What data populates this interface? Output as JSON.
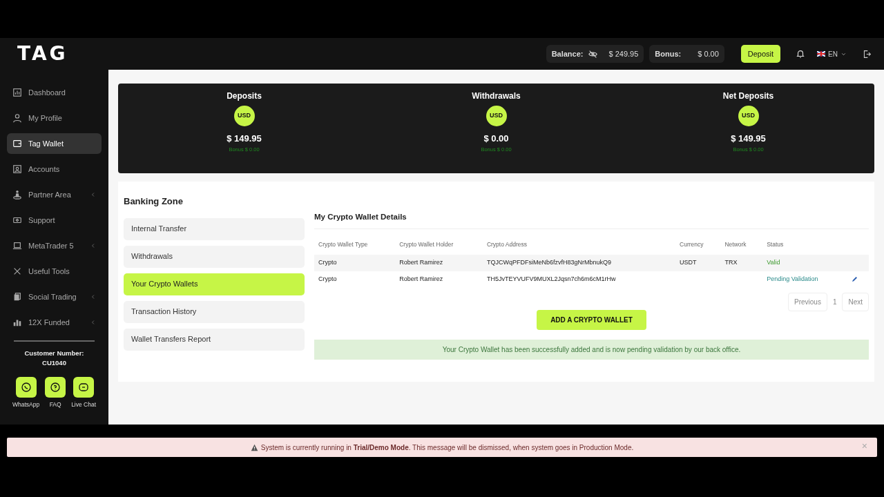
{
  "brand": "TAG",
  "header": {
    "balance_label": "Balance:",
    "balance_value": "$ 249.95",
    "bonus_label": "Bonus:",
    "bonus_value": "$ 0.00",
    "deposit_button": "Deposit",
    "language": "EN"
  },
  "sidebar": {
    "items": [
      {
        "label": "Dashboard",
        "selected": false,
        "submenu": false
      },
      {
        "label": "My Profile",
        "selected": false,
        "submenu": false
      },
      {
        "label": "Tag Wallet",
        "selected": true,
        "submenu": false
      },
      {
        "label": "Accounts",
        "selected": false,
        "submenu": false
      },
      {
        "label": "Partner Area",
        "selected": false,
        "submenu": true
      },
      {
        "label": "Support",
        "selected": false,
        "submenu": false
      },
      {
        "label": "MetaTrader 5",
        "selected": false,
        "submenu": true
      },
      {
        "label": "Useful Tools",
        "selected": false,
        "submenu": false
      },
      {
        "label": "Social Trading",
        "selected": false,
        "submenu": true
      },
      {
        "label": "12X Funded",
        "selected": false,
        "submenu": true
      }
    ],
    "customer_label": "Customer Number:",
    "customer_number": "CU1040",
    "contacts": [
      {
        "label": "WhatsApp"
      },
      {
        "label": "FAQ"
      },
      {
        "label": "Live Chat"
      }
    ]
  },
  "summary": [
    {
      "title": "Deposits",
      "currency": "USD",
      "amount": "$ 149.95",
      "bonus": "Bonus $ 0.00"
    },
    {
      "title": "Withdrawals",
      "currency": "USD",
      "amount": "$ 0.00",
      "bonus": "Bonus $ 0.00"
    },
    {
      "title": "Net Deposits",
      "currency": "USD",
      "amount": "$ 149.95",
      "bonus": "Bonus $ 0.00"
    }
  ],
  "banking_zone": {
    "title": "Banking Zone",
    "menu": [
      {
        "label": "Internal Transfer",
        "selected": false
      },
      {
        "label": "Withdrawals",
        "selected": false
      },
      {
        "label": "Your Crypto Wallets",
        "selected": true
      },
      {
        "label": "Transaction History",
        "selected": false
      },
      {
        "label": "Wallet Transfers Report",
        "selected": false
      }
    ]
  },
  "wallets": {
    "title": "My Crypto Wallet Details",
    "columns": [
      "Crypto Wallet Type",
      "Crypto Wallet Holder",
      "Crypto Address",
      "Currency",
      "Network",
      "Status"
    ],
    "rows": [
      {
        "cells": [
          "Crypto",
          "Robert Ramirez",
          "TQJCWqPFDFsiMeNb6fzvfH83gNrMbnukQ9",
          "USDT",
          "TRX"
        ],
        "status": "Valid",
        "kind": "valid",
        "editable": false
      },
      {
        "cells": [
          "Crypto",
          "Robert Ramirez",
          "TH5JvTEYVUFV9MUXL2Jqsn7ch6m6cM1rHw",
          "",
          ""
        ],
        "status": "Pending Validation",
        "kind": "pending",
        "editable": true
      }
    ],
    "pagination": {
      "previous": "Previous",
      "page": "1",
      "next": "Next"
    },
    "add_button": "ADD A CRYPTO WALLET",
    "success_message": "Your Crypto Wallet has been successfully added and is now pending validation by our back office."
  },
  "demo_alert": {
    "text": "System is currently running in **Trial/Demo Mode**. This message will be dismissed, when system goes in Production Mode.",
    "close": "×"
  }
}
